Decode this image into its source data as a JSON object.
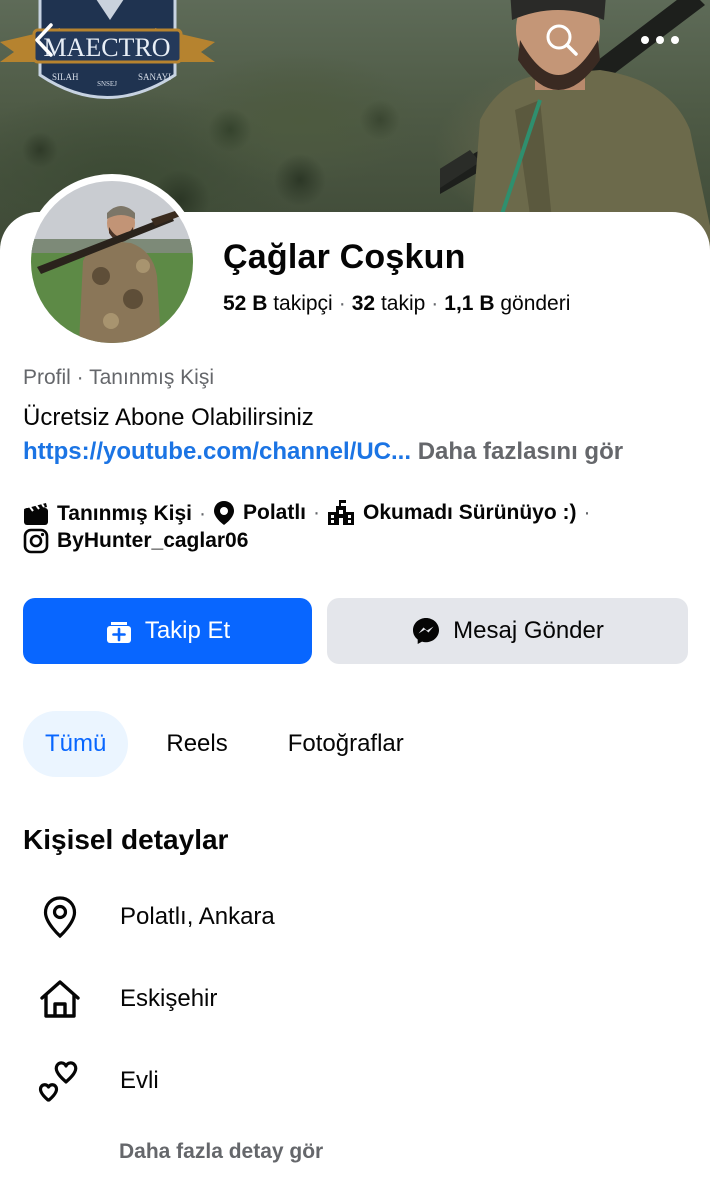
{
  "profile": {
    "name": "Çağlar Coşkun",
    "followers_count": "52 B",
    "followers_label": "takipçi",
    "following_count": "32",
    "following_label": "takip",
    "posts_count": "1,1 B",
    "posts_label": "gönderi",
    "category": "Profil · Tanınmış Kişi",
    "bio": "Ücretsiz Abone Olabilirsiniz",
    "bio_link": "https://youtube.com/channel/UC...",
    "bio_more": "Daha fazlasını gör"
  },
  "cover_logo": {
    "brand": "MAECTRO",
    "left_text": "SILAH",
    "right_text": "SANAYI",
    "ribbon": "SNSEJ"
  },
  "facts": [
    {
      "icon": "clapperboard-icon",
      "label": "Tanınmış Kişi"
    },
    {
      "icon": "location-pin-icon",
      "label": "Polatlı"
    },
    {
      "icon": "school-building-icon",
      "label": "Okumadı Sürünüyo :)"
    },
    {
      "icon": "instagram-icon",
      "label": "ByHunter_caglar06"
    }
  ],
  "actions": {
    "follow": "Takip Et",
    "message": "Mesaj Gönder"
  },
  "tabs": [
    {
      "label": "Tümü",
      "active": true
    },
    {
      "label": "Reels",
      "active": false
    },
    {
      "label": "Fotoğraflar",
      "active": false
    }
  ],
  "personal_details": {
    "title": "Kişisel detaylar",
    "items": [
      {
        "icon": "location-pin-icon",
        "label": "Polatlı, Ankara"
      },
      {
        "icon": "home-icon",
        "label": "Eskişehir"
      },
      {
        "icon": "hearts-icon",
        "label": "Evli"
      }
    ],
    "see_more": "Daha fazla detay gör"
  },
  "colors": {
    "primary": "#0866ff",
    "link": "#1b74e4",
    "secondary_text": "#65676b",
    "tab_active_bg": "#ebf5ff",
    "button_grey": "#e4e6eb"
  }
}
